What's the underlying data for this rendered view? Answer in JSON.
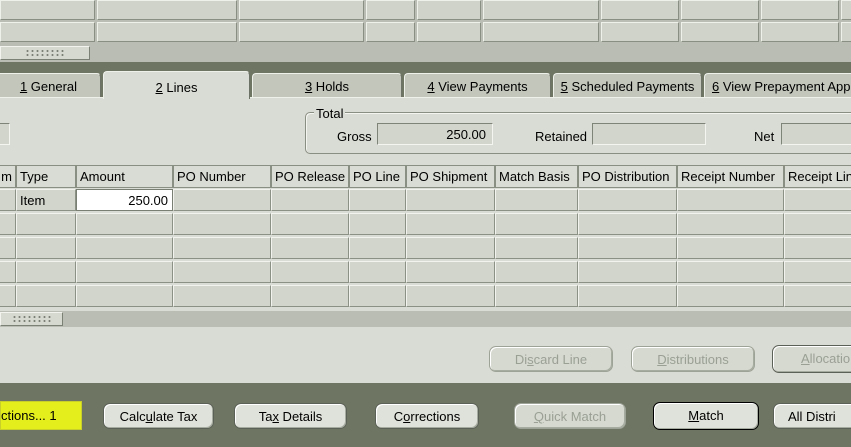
{
  "top_grid": {
    "rows": 2
  },
  "tabs": [
    {
      "num": "1",
      "label": " General",
      "active": false
    },
    {
      "num": "2",
      "label": " Lines",
      "active": true
    },
    {
      "num": "3",
      "label": " Holds",
      "active": false
    },
    {
      "num": "4",
      "label": " View Payments",
      "active": false
    },
    {
      "num": "5",
      "label": " Scheduled Payments",
      "active": false
    },
    {
      "num": "6",
      "label": " View Prepayment App",
      "active": false
    }
  ],
  "totals": {
    "legend": "Total",
    "gross_label": "Gross",
    "gross_value": "250.00",
    "retained_label": "Retained",
    "retained_value": "",
    "net_label": "Net",
    "net_value": ""
  },
  "lines_table": {
    "columns": [
      "m",
      "Type",
      "Amount",
      "PO Number",
      "PO Release",
      "PO Line",
      "PO Shipment",
      "Match Basis",
      "PO Distribution",
      "Receipt Number",
      "Receipt Lin"
    ],
    "rows": [
      [
        "",
        "Item",
        "250.00",
        "",
        "",
        "",
        "",
        "",
        "",
        "",
        ""
      ],
      [
        "",
        "",
        "",
        "",
        "",
        "",
        "",
        "",
        "",
        "",
        ""
      ],
      [
        "",
        "",
        "",
        "",
        "",
        "",
        "",
        "",
        "",
        "",
        ""
      ],
      [
        "",
        "",
        "",
        "",
        "",
        "",
        "",
        "",
        "",
        "",
        ""
      ],
      [
        "",
        "",
        "",
        "",
        "",
        "",
        "",
        "",
        "",
        "",
        ""
      ]
    ]
  },
  "line_buttons": {
    "discard": {
      "pre": "Di",
      "u": "s",
      "post": "card Line"
    },
    "distributions": {
      "pre": "",
      "u": "D",
      "post": "istributions"
    },
    "allocations": {
      "pre": "",
      "u": "A",
      "post": "llocatio"
    }
  },
  "bottom_buttons": {
    "actions": {
      "label": "ctions... 1"
    },
    "calculate_tax": {
      "pre": "Calc",
      "u": "u",
      "post": "late Tax"
    },
    "tax_details": {
      "pre": "Ta",
      "u": "x",
      "post": " Details"
    },
    "corrections": {
      "pre": "C",
      "u": "o",
      "post": "rrections"
    },
    "quick_match": {
      "pre": "",
      "u": "Q",
      "post": "uick Match"
    },
    "match": {
      "pre": "",
      "u": "M",
      "post": "atch"
    },
    "all_distributions": {
      "label": "All Distri"
    }
  },
  "colors": {
    "background_frame": "#6e7663",
    "panel": "#d9dcd4",
    "highlight": "#e4ee1d",
    "field_white": "#ffffff"
  }
}
